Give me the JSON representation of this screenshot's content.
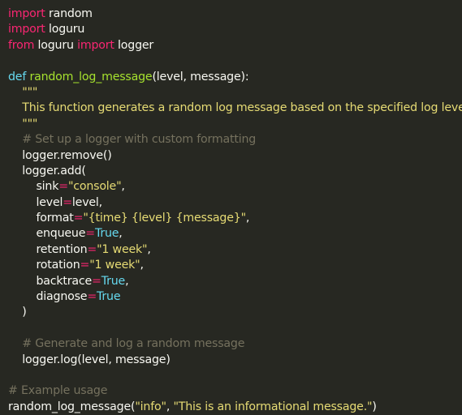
{
  "editor": {
    "lines": [
      [
        {
          "text": "import",
          "kind": "keyword"
        },
        {
          "text": " random",
          "kind": "name"
        }
      ],
      [
        {
          "text": "import",
          "kind": "keyword"
        },
        {
          "text": " loguru",
          "kind": "name"
        }
      ],
      [
        {
          "text": "from",
          "kind": "keyword"
        },
        {
          "text": " loguru ",
          "kind": "name"
        },
        {
          "text": "import",
          "kind": "keyword"
        },
        {
          "text": " logger",
          "kind": "name"
        }
      ],
      [],
      [
        {
          "text": "def",
          "kind": "const"
        },
        {
          "text": " ",
          "kind": "name"
        },
        {
          "text": "random_log_message",
          "kind": "func"
        },
        {
          "text": "(level, message):",
          "kind": "punct"
        }
      ],
      [
        {
          "text": "    \"\"\"",
          "kind": "string"
        }
      ],
      [
        {
          "text": "    This function generates a random log message based on the specified log level.",
          "kind": "string"
        }
      ],
      [
        {
          "text": "    \"\"\"",
          "kind": "string"
        }
      ],
      [
        {
          "text": "    # Set up a logger with custom formatting",
          "kind": "comment"
        }
      ],
      [
        {
          "text": "    logger.remove()",
          "kind": "name"
        }
      ],
      [
        {
          "text": "    logger.add(",
          "kind": "name"
        }
      ],
      [
        {
          "text": "        sink",
          "kind": "name"
        },
        {
          "text": "=",
          "kind": "op"
        },
        {
          "text": "\"console\"",
          "kind": "string"
        },
        {
          "text": ",",
          "kind": "punct"
        }
      ],
      [
        {
          "text": "        level",
          "kind": "name"
        },
        {
          "text": "=",
          "kind": "op"
        },
        {
          "text": "level,",
          "kind": "name"
        }
      ],
      [
        {
          "text": "        format",
          "kind": "name"
        },
        {
          "text": "=",
          "kind": "op"
        },
        {
          "text": "\"{time} {level} {message}\"",
          "kind": "string"
        },
        {
          "text": ",",
          "kind": "punct"
        }
      ],
      [
        {
          "text": "        enqueue",
          "kind": "name"
        },
        {
          "text": "=",
          "kind": "op"
        },
        {
          "text": "True",
          "kind": "const"
        },
        {
          "text": ",",
          "kind": "punct"
        }
      ],
      [
        {
          "text": "        retention",
          "kind": "name"
        },
        {
          "text": "=",
          "kind": "op"
        },
        {
          "text": "\"1 week\"",
          "kind": "string"
        },
        {
          "text": ",",
          "kind": "punct"
        }
      ],
      [
        {
          "text": "        rotation",
          "kind": "name"
        },
        {
          "text": "=",
          "kind": "op"
        },
        {
          "text": "\"1 week\"",
          "kind": "string"
        },
        {
          "text": ",",
          "kind": "punct"
        }
      ],
      [
        {
          "text": "        backtrace",
          "kind": "name"
        },
        {
          "text": "=",
          "kind": "op"
        },
        {
          "text": "True",
          "kind": "const"
        },
        {
          "text": ",",
          "kind": "punct"
        }
      ],
      [
        {
          "text": "        diagnose",
          "kind": "name"
        },
        {
          "text": "=",
          "kind": "op"
        },
        {
          "text": "True",
          "kind": "const"
        }
      ],
      [
        {
          "text": "    )",
          "kind": "punct"
        }
      ],
      [],
      [
        {
          "text": "    # Generate and log a random message",
          "kind": "comment"
        }
      ],
      [
        {
          "text": "    logger.log(level, message)",
          "kind": "name"
        }
      ],
      [],
      [
        {
          "text": "# Example usage",
          "kind": "comment"
        }
      ],
      [
        {
          "text": "random_log_message(",
          "kind": "name"
        },
        {
          "text": "\"info\"",
          "kind": "string"
        },
        {
          "text": ", ",
          "kind": "punct"
        },
        {
          "text": "\"This is an informational message.\"",
          "kind": "string"
        },
        {
          "text": ")",
          "kind": "punct"
        }
      ]
    ]
  },
  "theme": {
    "background": "#272822",
    "keyword": "#f92672",
    "function": "#a6e22e",
    "string": "#e6db74",
    "comment": "#75715e",
    "constant": "#66d9ef",
    "default": "#f8f8f2"
  }
}
